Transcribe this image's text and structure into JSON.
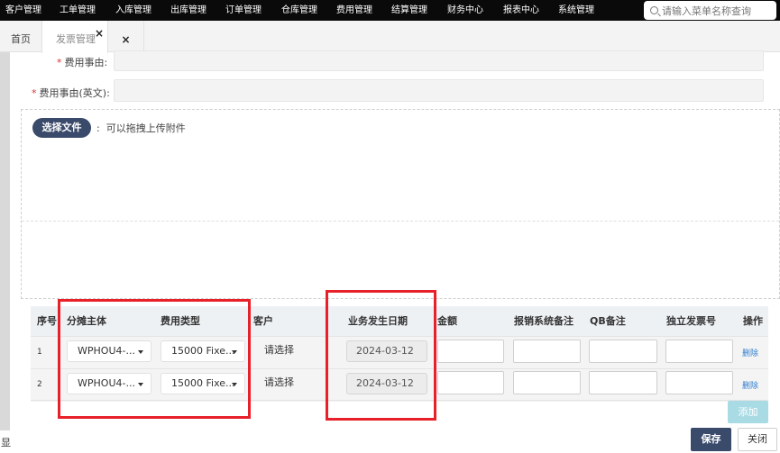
{
  "top_nav": {
    "items": [
      "客户管理",
      "工单管理",
      "入库管理",
      "出库管理",
      "订单管理",
      "仓库管理",
      "费用管理",
      "结算管理",
      "财务中心",
      "报表中心",
      "系统管理"
    ],
    "search_placeholder": "请输入菜单名称查询"
  },
  "tabs": {
    "home": "首页",
    "invoice": "发票管理",
    "close_glyph": "×"
  },
  "form": {
    "reason_label": "费用事由:",
    "reason_en_label": "费用事由(英文):",
    "required_mark": "*",
    "reason_value": "",
    "reason_en_value": ""
  },
  "upload": {
    "choose_label": "选择文件",
    "separator": ":",
    "hint": "可以拖拽上传附件"
  },
  "table": {
    "headers": [
      "序号",
      "分摊主体",
      "费用类型",
      "客户",
      "业务发生日期",
      "金额",
      "报销系统备注",
      "QB备注",
      "独立发票号",
      "操作"
    ],
    "rows": [
      {
        "index": "1",
        "entity": "WPHOU4-...",
        "fee_type": "15000 Fixe...",
        "customer": "请选择",
        "date": "2024-03-12",
        "action": "删除"
      },
      {
        "index": "2",
        "entity": "WPHOU4-...",
        "fee_type": "15000 Fixe...",
        "customer": "请选择",
        "date": "2024-03-12",
        "action": "删除"
      }
    ]
  },
  "buttons": {
    "add": "添加",
    "save": "保存",
    "close": "关闭"
  },
  "side_char": "显",
  "colors": {
    "nav_bg": "#0a0a0a",
    "primary": "#3a4a6a",
    "highlight_box": "#e8202a",
    "link": "#2f7fd0",
    "add_button": "#a9dbe4"
  }
}
